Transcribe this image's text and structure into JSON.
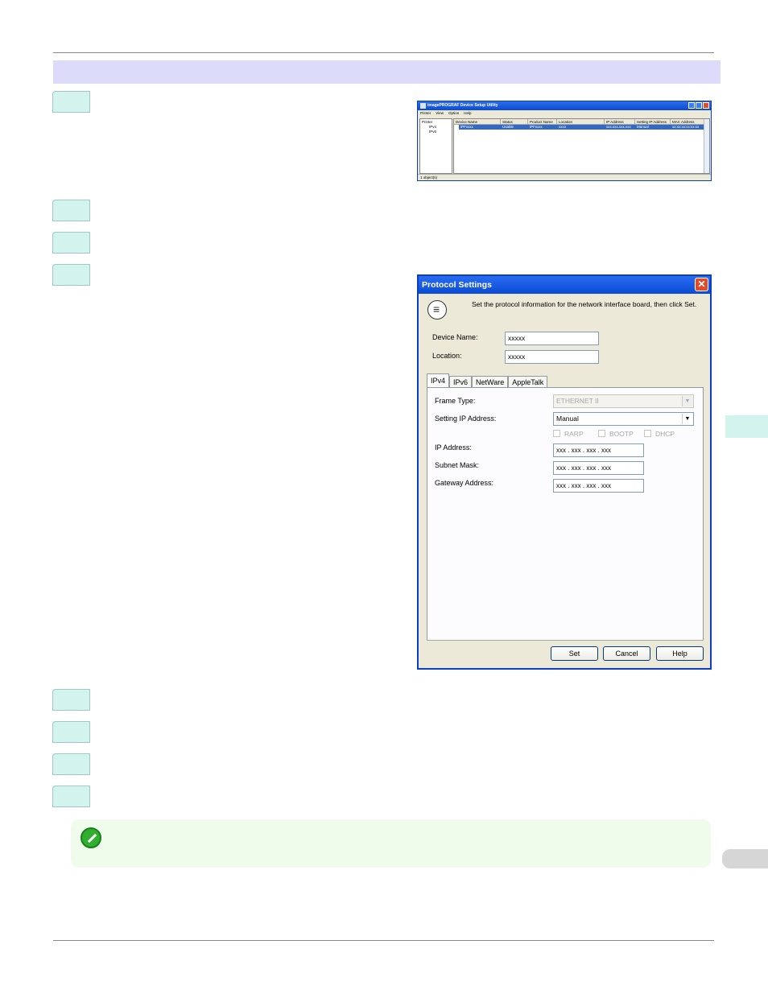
{
  "device_setup_window": {
    "title": "imagePROGRAF Device Setup Utility",
    "menu": [
      "Printer",
      "View",
      "Option",
      "Help"
    ],
    "tree": [
      "Printer",
      "IPv4",
      "IPv6"
    ],
    "columns": [
      "Device Name",
      "Status",
      "Product Name",
      "Location",
      "IP Address",
      "Setting IP Address",
      "MAC Address"
    ],
    "row": [
      "iPFxxxx",
      "Usable",
      "iPFxxxx",
      "xxxx",
      "xxx.xxx.xxx.xxx",
      "Manual",
      "xx:xx:xx:xx:xx:xx"
    ],
    "status": "1 object(s)"
  },
  "protocol_dialog": {
    "title": "Protocol Settings",
    "instruction": "Set the protocol information for the network interface board, then click Set.",
    "device_name_label": "Device Name:",
    "device_name_value": "xxxxx",
    "location_label": "Location:",
    "location_value": "xxxxx",
    "tabs": [
      "IPv4",
      "IPv6",
      "NetWare",
      "AppleTalk"
    ],
    "frame_type_label": "Frame Type:",
    "frame_type_value": "ETHERNET II",
    "setting_ip_label": "Setting IP Address:",
    "setting_ip_value": "Manual",
    "checkboxes": [
      "RARP",
      "BOOTP",
      "DHCP"
    ],
    "ip_address_label": "IP Address:",
    "subnet_mask_label": "Subnet Mask:",
    "gateway_label": "Gateway Address:",
    "ip_value": "xxx . xxx . xxx . xxx",
    "subnet_value": "xxx . xxx . xxx . xxx",
    "gateway_value": "xxx . xxx . xxx . xxx",
    "buttons": {
      "set": "Set",
      "cancel": "Cancel",
      "help": "Help"
    }
  },
  "icons": {
    "note": "pencil-note-icon",
    "dialog_info": "speech-balloon-icon",
    "close": "close-icon"
  }
}
